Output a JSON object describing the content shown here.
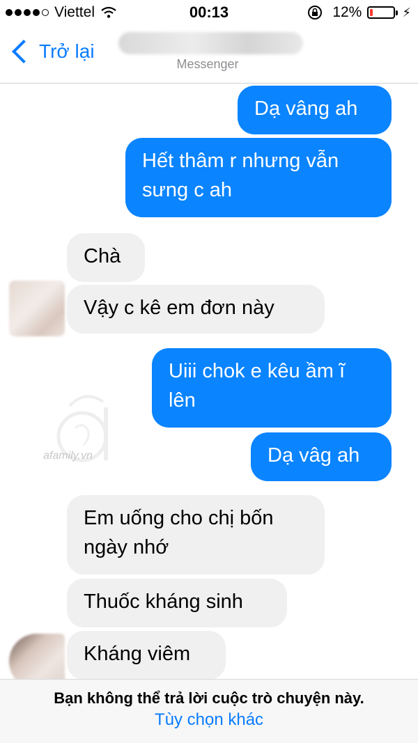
{
  "status_bar": {
    "carrier": "Viettel",
    "time": "00:13",
    "battery": "12%",
    "battery_level": 0.12,
    "battery_color": "#ff3b30"
  },
  "nav": {
    "back_label": "Trở lại",
    "subtitle": "Messenger",
    "back_icon": "chevron-left-icon"
  },
  "messages": [
    {
      "direction": "outgoing",
      "text": "Dạ vâng ah"
    },
    {
      "direction": "outgoing",
      "lines": [
        "Hết thâm r nhưng vẫn",
        "sưng c ah"
      ]
    },
    {
      "direction": "incoming",
      "text": "Chà"
    },
    {
      "direction": "incoming",
      "text": "Vậy c kê em đơn này"
    },
    {
      "direction": "outgoing",
      "lines": [
        "Uiii chok e kêu ầm ĩ",
        "lên"
      ]
    },
    {
      "direction": "outgoing",
      "text": "Dạ vâg ah"
    },
    {
      "direction": "incoming",
      "lines": [
        "Em uống cho chị bốn",
        "ngày nhớ"
      ]
    },
    {
      "direction": "incoming",
      "text": "Thuốc kháng sinh"
    },
    {
      "direction": "incoming",
      "text": "Kháng viêm"
    }
  ],
  "watermark": "afamily.vn",
  "bottom": {
    "message": "Bạn không thể trả lời cuộc trò chuyện này.",
    "link": "Tùy chọn khác"
  },
  "colors": {
    "accent": "#0a7cff",
    "outgoing_bubble": "#0a84ff",
    "incoming_bubble": "#f0f0f0"
  }
}
